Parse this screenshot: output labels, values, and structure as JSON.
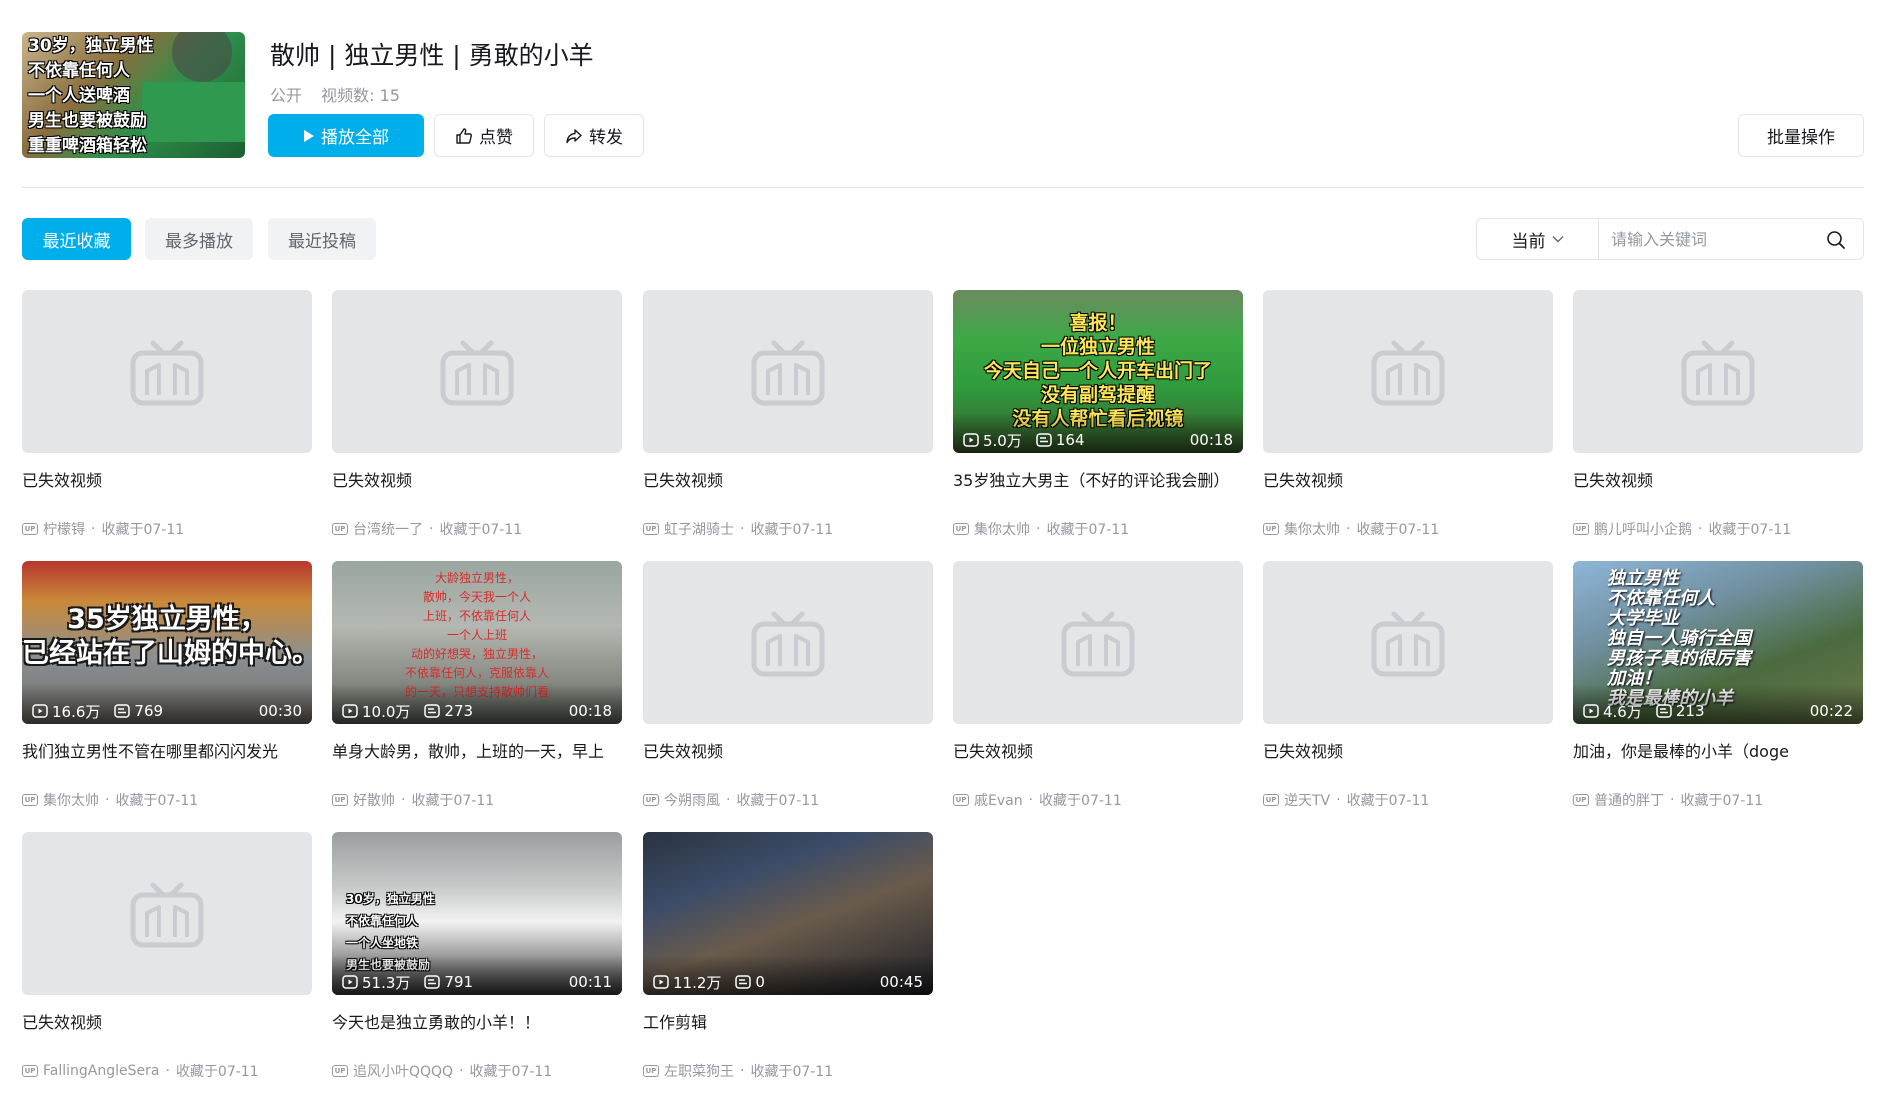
{
  "header": {
    "cover_text": [
      "30岁，独立男性",
      "不依靠任何人",
      "一个人送啤酒",
      "男生也要被鼓励",
      "重重啤酒箱轻松"
    ],
    "title": "散帅 | 独立男性 | 勇敢的小羊",
    "visibility": "公开",
    "video_count": "视频数: 15",
    "play_all": "播放全部",
    "like": "点赞",
    "share": "转发",
    "batch": "批量操作"
  },
  "tabs": [
    "最近收藏",
    "最多播放",
    "最近投稿"
  ],
  "search": {
    "scope": "当前",
    "placeholder": "请输入关键词"
  },
  "up_badge": "UP",
  "videos": [
    {
      "title": "已失效视频",
      "author": "柠檬锝",
      "collected": "收藏于07-11",
      "invalid": true
    },
    {
      "title": "已失效视频",
      "author": "台湾统一了",
      "collected": "收藏于07-11",
      "invalid": true
    },
    {
      "title": "已失效视频",
      "author": "虹子湖骑士",
      "collected": "收藏于07-11",
      "invalid": true
    },
    {
      "title": "35岁独立大男主（不好的评论我会删）",
      "author": "集你太帅",
      "collected": "收藏于07-11",
      "invalid": false,
      "views": "5.0万",
      "comments": "164",
      "duration": "00:18",
      "overlay": [
        "喜报！",
        "一位独立男性",
        "今天自己一个人开车出门了",
        "没有副驾提醒",
        "没有人帮忙看后视镜"
      ]
    },
    {
      "title": "已失效视频",
      "author": "集你太帅",
      "collected": "收藏于07-11",
      "invalid": true
    },
    {
      "title": "已失效视频",
      "author": "鹏儿呼叫小企鹅",
      "collected": "收藏于07-11",
      "invalid": true
    },
    {
      "title": "我们独立男性不管在哪里都闪闪发光",
      "author": "集你太帅",
      "collected": "收藏于07-11",
      "invalid": false,
      "views": "16.6万",
      "comments": "769",
      "duration": "00:30",
      "overlay": [
        "35岁独立男性，",
        "已经站在了山姆的中心。"
      ]
    },
    {
      "title": "单身大龄男，散帅，上班的一天，早上",
      "author": "好散帅",
      "collected": "收藏于07-11",
      "invalid": false,
      "views": "10.0万",
      "comments": "273",
      "duration": "00:18",
      "overlay": [
        "大龄独立男性，",
        "散帅，今天我一个人",
        "上班，不依靠任何人",
        "一个人上班",
        "动的好想哭，独立男性，",
        "不依靠任何人，克服依靠人",
        "的一天，只想支持散帅们看"
      ]
    },
    {
      "title": "已失效视频",
      "author": "今朔雨風",
      "collected": "收藏于07-11",
      "invalid": true
    },
    {
      "title": "已失效视频",
      "author": "戚Evan",
      "collected": "收藏于07-11",
      "invalid": true
    },
    {
      "title": "已失效视频",
      "author": "逆天TV",
      "collected": "收藏于07-11",
      "invalid": true
    },
    {
      "title": "加油，你是最棒的小羊（doge",
      "author": "普通的胖丁",
      "collected": "收藏于07-11",
      "invalid": false,
      "views": "4.6万",
      "comments": "213",
      "duration": "00:22",
      "overlay": [
        "独立男性",
        "不依靠任何人",
        "大学毕业",
        "独自一人骑行全国",
        "男孩子真的很厉害",
        "加油！",
        "我是最棒的小羊"
      ]
    },
    {
      "title": "已失效视频",
      "author": "FallingAngleSera",
      "collected": "收藏于07-11",
      "invalid": true
    },
    {
      "title": "今天也是独立勇敢的小羊！！",
      "author": "追风小叶QQQQ",
      "collected": "收藏于07-11",
      "invalid": false,
      "views": "51.3万",
      "comments": "791",
      "duration": "00:11",
      "overlay": [
        "30岁，独立男性",
        "不依靠任何人",
        "一个人坐地铁",
        "男生也要被鼓励"
      ]
    },
    {
      "title": "工作剪辑",
      "author": "左职菜狗王",
      "collected": "收藏于07-11",
      "invalid": false,
      "views": "11.2万",
      "comments": "0",
      "duration": "00:45",
      "overlay": []
    }
  ]
}
